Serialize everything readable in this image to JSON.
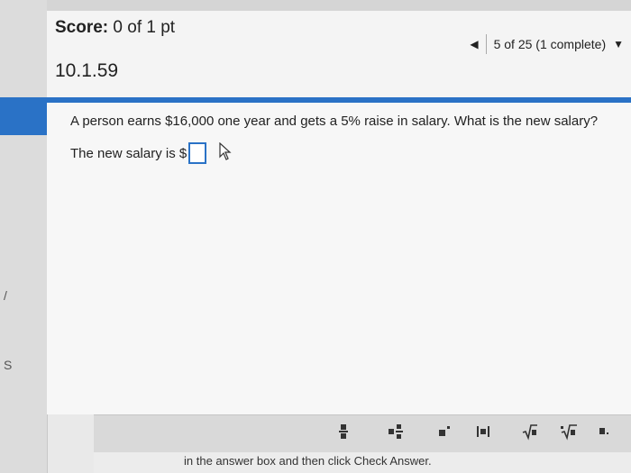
{
  "header": {
    "score_label": "Score:",
    "score_value": "0 of 1 pt",
    "progress": "5 of 25 (1 complete)",
    "question_id": "10.1.59"
  },
  "question": {
    "text": "A person earns $16,000 one year and gets a 5% raise in salary. What is the new salary?",
    "answer_prefix": "The new salary is $",
    "answer_value": ""
  },
  "sidebar": {
    "glyph_1": "/",
    "glyph_2": "S"
  },
  "toolbar": {
    "tools": [
      "fraction",
      "mixed-number",
      "exponent",
      "absolute-value",
      "square-root",
      "nth-root",
      "decimal"
    ]
  },
  "footer": {
    "instruction": "in the answer box and then click Check Answer."
  },
  "colors": {
    "accent": "#2a72c6",
    "background": "#f7f7f7"
  }
}
